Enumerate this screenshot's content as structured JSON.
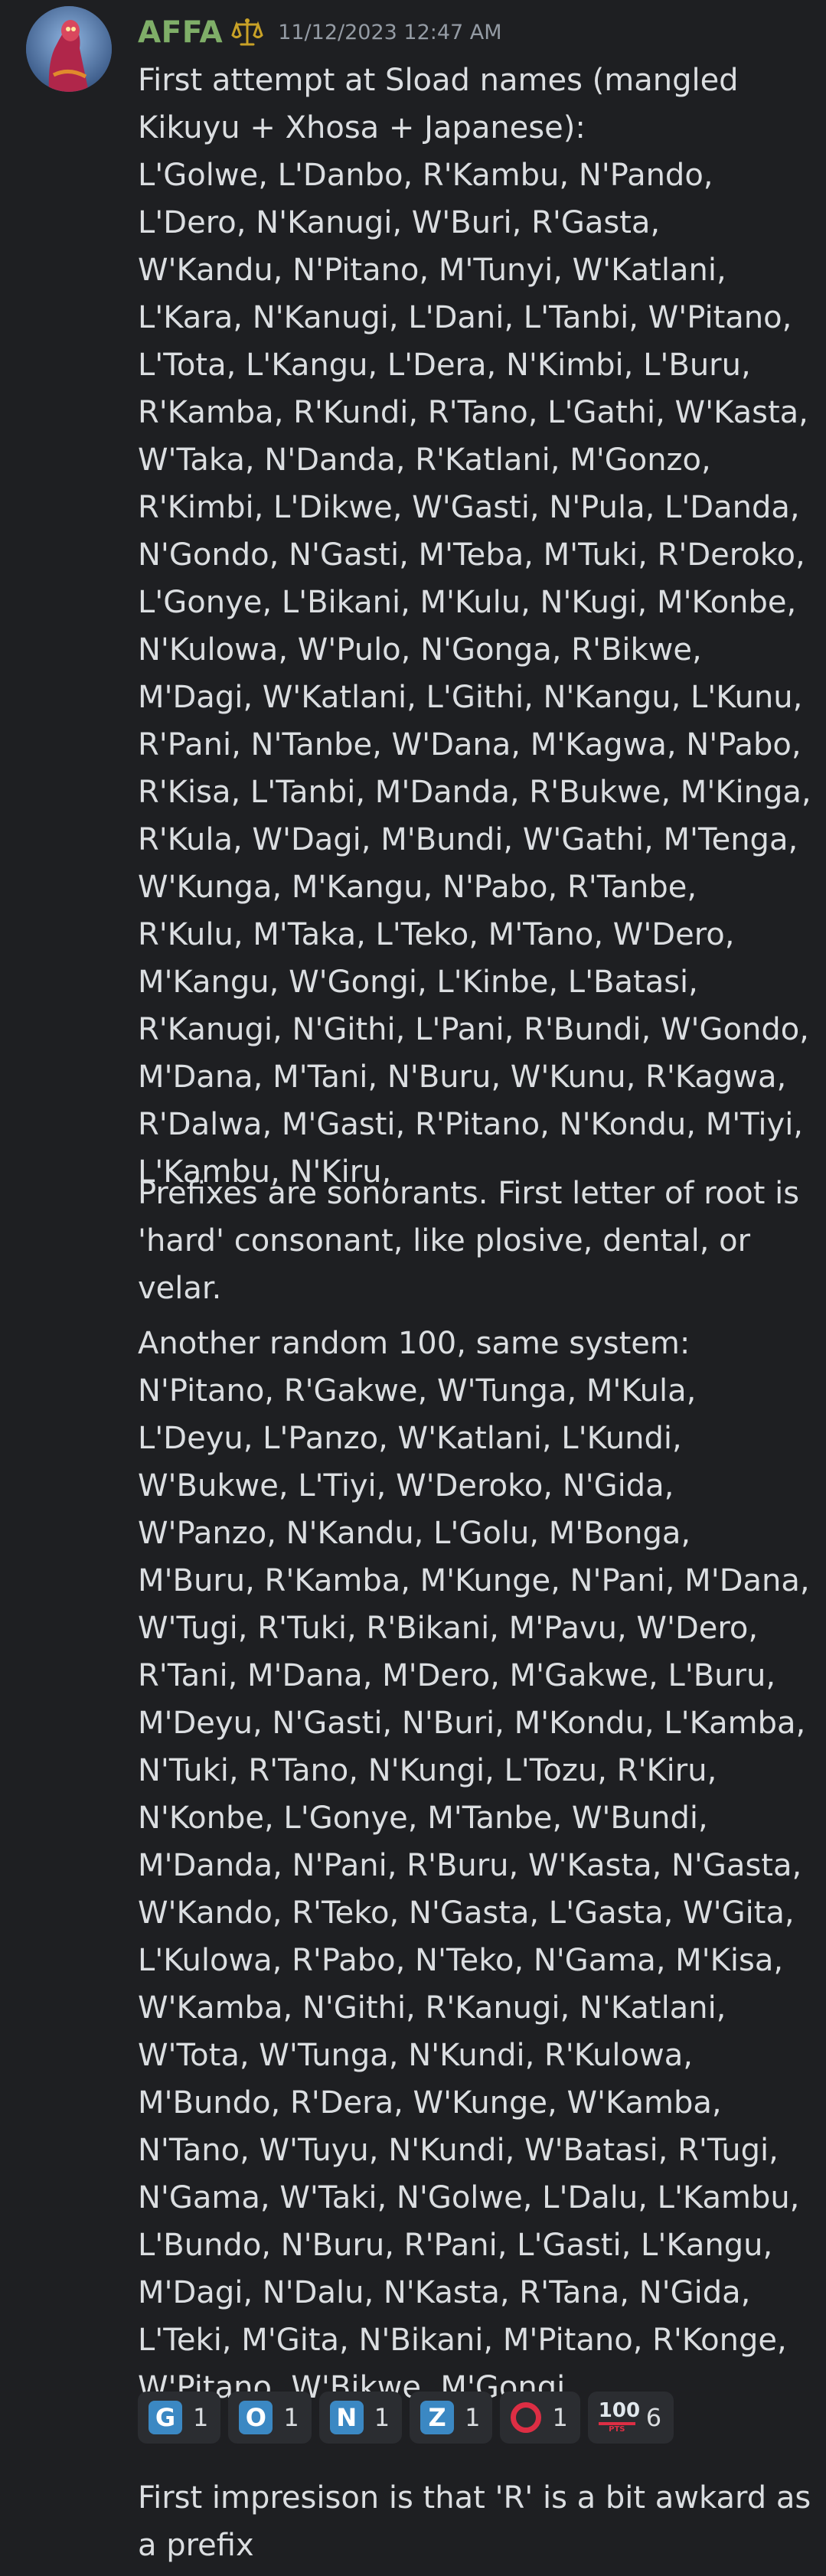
{
  "message": {
    "author": "AFFA",
    "timestamp": "11/12/2023 12:47 AM",
    "role_icon": "scales-icon",
    "paragraphs": [
      "First attempt at Sload names (mangled Kikuyu + Xhosa + Japanese):\nL'Golwe, L'Danbo, R'Kambu, N'Pando, L'Dero, N'Kanugi, W'Buri, R'Gasta, W'Kandu, N'Pitano, M'Tunyi, W'Katlani, L'Kara, N'Kanugi, L'Dani, L'Tanbi, W'Pitano, L'Tota, L'Kangu, L'Dera, N'Kimbi, L'Buru, R'Kamba, R'Kundi, R'Tano, L'Gathi, W'Kasta, W'Taka, N'Danda, R'Katlani, M'Gonzo, R'Kimbi, L'Dikwe, W'Gasti, N'Pula, L'Danda, N'Gondo, N'Gasti, M'Teba, M'Tuki, R'Deroko, L'Gonye, L'Bikani, M'Kulu, N'Kugi, M'Konbe, N'Kulowa, W'Pulo, N'Gonga, R'Bikwe, M'Dagi, W'Katlani, L'Githi, N'Kangu, L'Kunu, R'Pani, N'Tanbe, W'Dana, M'Kagwa, N'Pabo, R'Kisa, L'Tanbi, M'Danda, R'Bukwe, M'Kinga, R'Kula, W'Dagi, M'Bundi, W'Gathi, M'Tenga, W'Kunga, M'Kangu, N'Pabo, R'Tanbe, R'Kulu, M'Taka, L'Teko, M'Tano, W'Dero, M'Kangu, W'Gongi, L'Kinbe, L'Batasi, R'Kanugi, N'Githi, L'Pani, R'Bundi, W'Gondo, M'Dana, M'Tani, N'Buru, W'Kunu, R'Kagwa, R'Dalwa, M'Gasti, R'Pitano, N'Kondu, M'Tiyi, L'Kambu, N'Kiru,",
      "Prefixes are sonorants. First letter of root is 'hard' consonant, like plosive, dental, or velar.",
      "Another random 100, same system:\nN'Pitano, R'Gakwe, W'Tunga, M'Kula, L'Deyu, L'Panzo, W'Katlani, L'Kundi, W'Bukwe, L'Tiyi, W'Deroko, N'Gida, W'Panzo, N'Kandu, L'Golu, M'Bonga, M'Buru, R'Kamba, M'Kunge, N'Pani, M'Dana, W'Tugi, R'Tuki, R'Bikani, M'Pavu, W'Dero, R'Tani, M'Dana, M'Dero, M'Gakwe, L'Buru, M'Deyu, N'Gasti, N'Buri, M'Kondu, L'Kamba, N'Tuki, R'Tano, N'Kungi, L'Tozu, R'Kiru, N'Konbe, L'Gonye, M'Tanbe, W'Bundi, M'Danda, N'Pani, R'Buru, W'Kasta, N'Gasta, W'Kando, R'Teko, N'Gasta, L'Gasta, W'Gita, L'Kulowa, R'Pabo, N'Teko, N'Gama, M'Kisa, W'Kamba, N'Githi, R'Kanugi, N'Katlani, W'Tota, W'Tunga, N'Kundi, R'Kulowa, M'Bundo, R'Dera, W'Kunge, W'Kamba, N'Tano, W'Tuyu, N'Kundi, W'Batasi, R'Tugi, N'Gama, W'Taki, N'Golwe, L'Dalu, L'Kambu, L'Bundo, N'Buru, R'Pani, L'Gasti, L'Kangu, M'Dagi, N'Dalu, N'Kasta, R'Tana, N'Gida, L'Teki, M'Gita, N'Bikani, M'Pitano, R'Konge, W'Pitano, W'Bikwe, M'Gongi,"
    ],
    "reactions": [
      {
        "icon": "regional-indicator-g-icon",
        "glyph": "G",
        "count": "1"
      },
      {
        "icon": "regional-indicator-o-icon",
        "glyph": "O",
        "count": "1"
      },
      {
        "icon": "regional-indicator-n-icon",
        "glyph": "N",
        "count": "1"
      },
      {
        "icon": "regional-indicator-z-icon",
        "glyph": "Z",
        "count": "1"
      },
      {
        "icon": "heavy-circle-icon",
        "glyph": "",
        "count": "1"
      },
      {
        "icon": "hundred-points-icon",
        "glyph": "100",
        "glyph_sub": "PTS",
        "count": "6"
      }
    ],
    "colors": {
      "background": "#1e1f22",
      "username": "#7fae68",
      "timestamp": "#949ba4",
      "text": "#dbdee1",
      "reaction_bg": "#2b2d31",
      "indicator_blue": "#3b88c3",
      "red": "#dd2e44"
    }
  },
  "next_message": {
    "text": "First impresison is that 'R' is a bit awkard as a prefix"
  }
}
